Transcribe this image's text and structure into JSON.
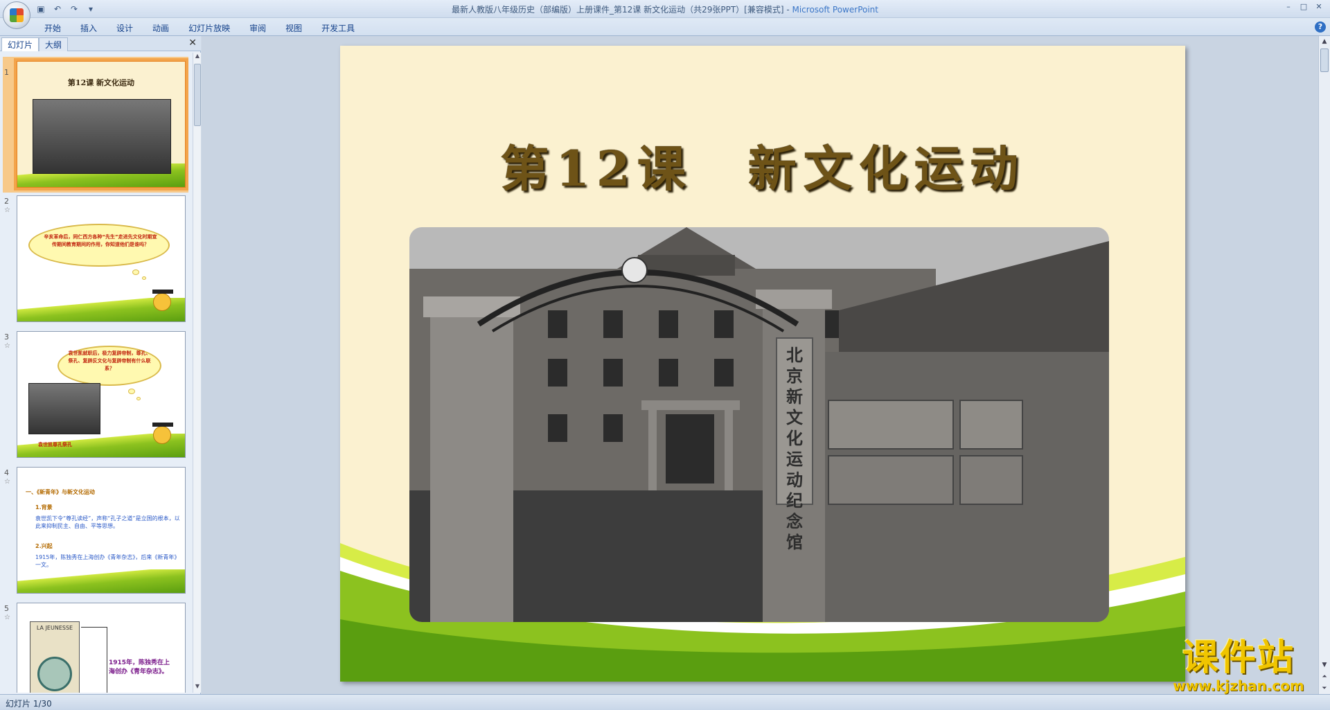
{
  "window": {
    "title": "最新人教版八年级历史（部编版）上册课件_第12课  新文化运动（共29张PPT）[兼容模式] - ",
    "app_name": "Microsoft PowerPoint",
    "min": "–",
    "max": "□",
    "close": "✕"
  },
  "ribbon": {
    "tabs": [
      "开始",
      "插入",
      "设计",
      "动画",
      "幻灯片放映",
      "审阅",
      "视图",
      "开发工具"
    ],
    "help": "?"
  },
  "left_pane": {
    "tabs": [
      "幻灯片",
      "大纲"
    ],
    "close": "✕",
    "thumbnails": [
      {
        "num": "1",
        "title": "第12课  新文化运动"
      },
      {
        "num": "2",
        "text": "辛亥革命后，同仁西方各种“先生”走进先文化时期宣传期间教育期间的作用，你知道他们是谁吗？"
      },
      {
        "num": "3",
        "text": "袁世凯就职后，极力复辟帝制，尊孔、祭孔、复辟反文化与复辟帝制有什么联系？",
        "caption": "袁世凯尊孔祭孔"
      },
      {
        "num": "4",
        "heading": "一、《新青年》与新文化运动",
        "sub1": "1.背景",
        "text1": "袁世凯下令“尊孔读经”，声称“孔子之道”是立国的根本，以此来抑制民主、自由、平等思想。",
        "sub2": "2.兴起",
        "text2": "1915年，陈独秀在上海创办《青年杂志》，后来《新青年》一文。"
      },
      {
        "num": "5",
        "cover": "LA JEUNESSE",
        "text": "1915年，陈独秀在上海创办《青年杂志》。"
      }
    ]
  },
  "slide": {
    "title": "第12课　新文化运动",
    "plaque": "北京新文化运动纪念馆"
  },
  "status": {
    "slide_indicator": "幻灯片 1/30"
  },
  "watermark": {
    "big": "课件站",
    "url": "www.kjzhan.com"
  },
  "colors": {
    "slide_bg": "#fbf1d0",
    "title": "#6e5317",
    "grass_light": "#cfe83f",
    "grass_dark": "#5a9e10",
    "selection": "#f3a44b"
  }
}
